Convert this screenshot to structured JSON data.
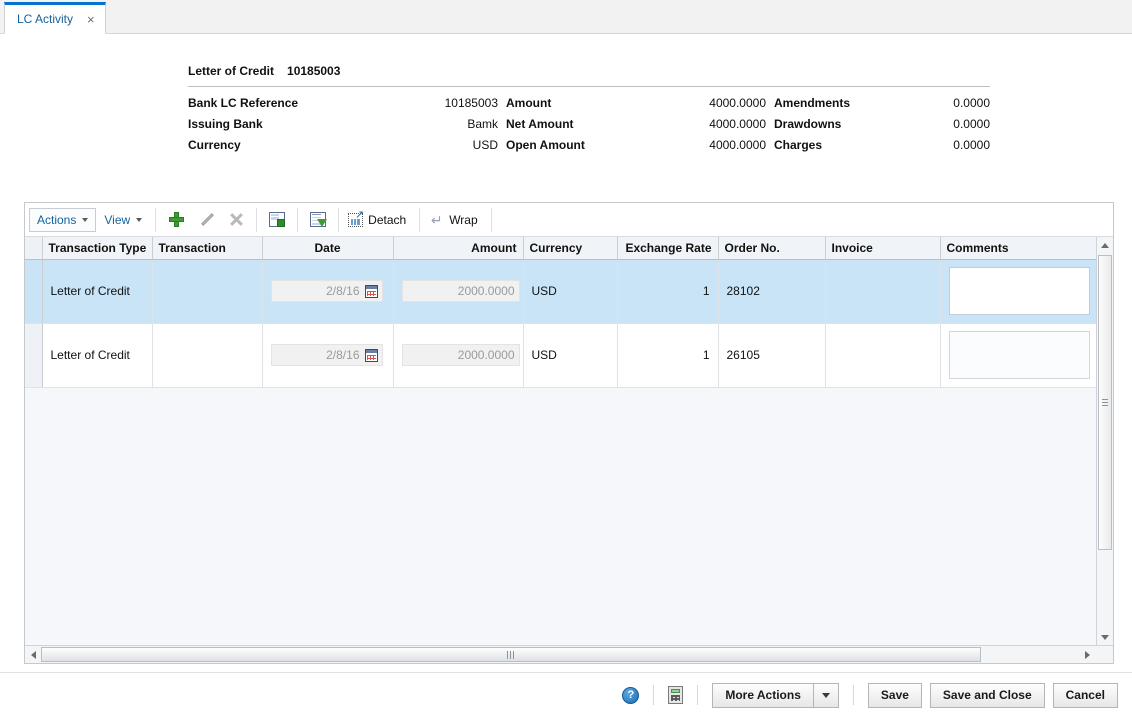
{
  "tab": {
    "label": "LC Activity",
    "close_glyph": "×"
  },
  "summary": {
    "title_label": "Letter of Credit",
    "title_value": "10185003",
    "fields": [
      {
        "label": "Bank LC Reference",
        "value": "10185003"
      },
      {
        "label": "Amount",
        "value": "4000.0000"
      },
      {
        "label": "Amendments",
        "value": "0.0000"
      },
      {
        "label": "Issuing Bank",
        "value": "Bamk"
      },
      {
        "label": "Net Amount",
        "value": "4000.0000"
      },
      {
        "label": "Drawdowns",
        "value": "0.0000"
      },
      {
        "label": "Currency",
        "value": "USD"
      },
      {
        "label": "Open Amount",
        "value": "4000.0000"
      },
      {
        "label": "Charges",
        "value": "0.0000"
      }
    ]
  },
  "toolbar": {
    "actions_label": "Actions",
    "view_label": "View",
    "add_icon": "plus-icon",
    "edit_icon": "pencil-icon",
    "delete_icon": "delete-x-icon",
    "export_icon": "export-to-excel-icon",
    "query_icon": "query-by-example-icon",
    "detach_label": "Detach",
    "detach_icon": "detach-icon",
    "wrap_label": "Wrap",
    "wrap_icon": "wrap-icon"
  },
  "table": {
    "columns": [
      "Transaction Type",
      "Transaction",
      "Date",
      "Amount",
      "Currency",
      "Exchange Rate",
      "Order No.",
      "Invoice",
      "Comments"
    ],
    "rows": [
      {
        "transaction_type": "Letter of Credit",
        "transaction": "",
        "date": "2/8/16",
        "amount": "2000.0000",
        "currency": "USD",
        "exchange_rate": "1",
        "order_no": "28102",
        "invoice": "",
        "comments": "",
        "selected": true
      },
      {
        "transaction_type": "Letter of Credit",
        "transaction": "",
        "date": "2/8/16",
        "amount": "2000.0000",
        "currency": "USD",
        "exchange_rate": "1",
        "order_no": "26105",
        "invoice": "",
        "comments": "",
        "selected": false
      }
    ]
  },
  "footer": {
    "help_icon": "help-icon",
    "help_glyph": "?",
    "calculator_icon": "calculator-icon",
    "more_actions_label": "More Actions",
    "save_label": "Save",
    "save_and_close_label": "Save and Close",
    "cancel_label": "Cancel"
  },
  "colors": {
    "tab_accent": "#0572ce",
    "link_blue": "#13639e",
    "selected_row": "#c9e3f7",
    "panel_bg": "#f6f7fb",
    "header_bg": "#f0f3f7"
  }
}
